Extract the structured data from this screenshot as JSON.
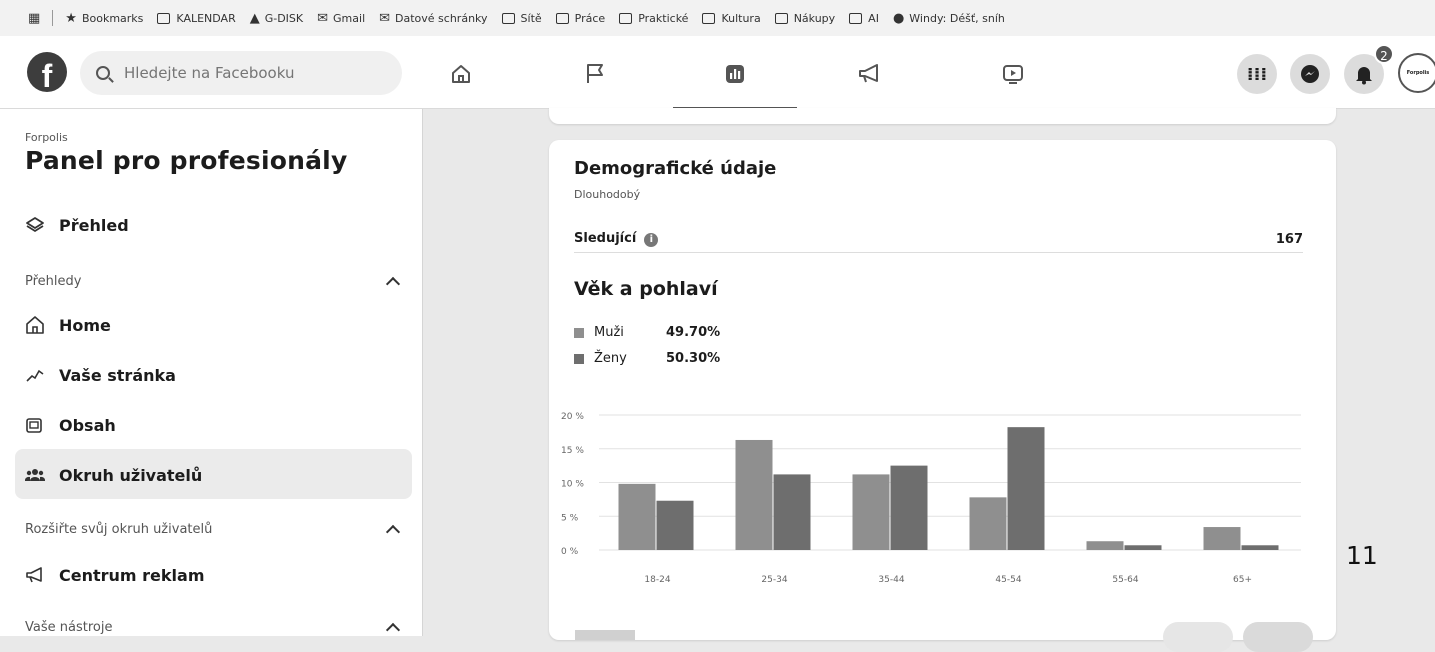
{
  "bookmarks": [
    {
      "label": "Bookmarks",
      "icon": "star-icon"
    },
    {
      "label": "KALENDAR",
      "icon": "calendar-icon"
    },
    {
      "label": "G-DISK",
      "icon": "drive-icon"
    },
    {
      "label": "Gmail",
      "icon": "gmail-icon"
    },
    {
      "label": "Datové schránky",
      "icon": "mailbox-icon"
    },
    {
      "label": "Sítě",
      "icon": "folder-icon"
    },
    {
      "label": "Práce",
      "icon": "folder-icon"
    },
    {
      "label": "Praktické",
      "icon": "folder-icon"
    },
    {
      "label": "Kultura",
      "icon": "folder-icon"
    },
    {
      "label": "Nákupy",
      "icon": "folder-icon"
    },
    {
      "label": "AI",
      "icon": "folder-icon"
    },
    {
      "label": "Windy: Déšť, sníh",
      "icon": "windy-icon"
    }
  ],
  "header": {
    "search_placeholder": "Hledejte na Facebooku",
    "notification_count": "2",
    "avatar_text": "Forpolis"
  },
  "sidebar": {
    "brand": "Forpolis",
    "title": "Panel pro profesionály",
    "overview": "Přehled",
    "sections": [
      {
        "label": "Přehledy"
      },
      {
        "label": "Rozšiřte svůj okruh uživatelů"
      },
      {
        "label": "Vaše nástroje"
      }
    ],
    "items": [
      {
        "label": "Home"
      },
      {
        "label": "Vaše stránka"
      },
      {
        "label": "Obsah"
      },
      {
        "label": "Okruh uživatelů"
      },
      {
        "label": "Centrum reklam"
      }
    ]
  },
  "main": {
    "card_title": "Demografické údaje",
    "card_subtitle": "Dlouhodobý",
    "followers_label": "Sledující",
    "followers_value": "167",
    "section_title": "Věk a pohlaví",
    "legend": [
      {
        "label": "Muži",
        "value": "49.70%",
        "color": "#8f8f8f"
      },
      {
        "label": "Ženy",
        "value": "50.30%",
        "color": "#6e6e6e"
      }
    ]
  },
  "page_number": "11",
  "chart_data": {
    "type": "bar",
    "categories": [
      "18-24",
      "25-34",
      "35-44",
      "45-54",
      "55-64",
      "65+"
    ],
    "series": [
      {
        "name": "Muži",
        "values": [
          9.8,
          16.3,
          11.2,
          7.8,
          1.3,
          3.4
        ],
        "color": "#8f8f8f"
      },
      {
        "name": "Ženy",
        "values": [
          7.3,
          11.2,
          12.5,
          18.2,
          0.7,
          0.7
        ],
        "color": "#6e6e6e"
      }
    ],
    "yticks": [
      "0 %",
      "5 %",
      "10 %",
      "15 %",
      "20 %"
    ],
    "ylim": [
      0,
      20
    ],
    "grid": true
  }
}
